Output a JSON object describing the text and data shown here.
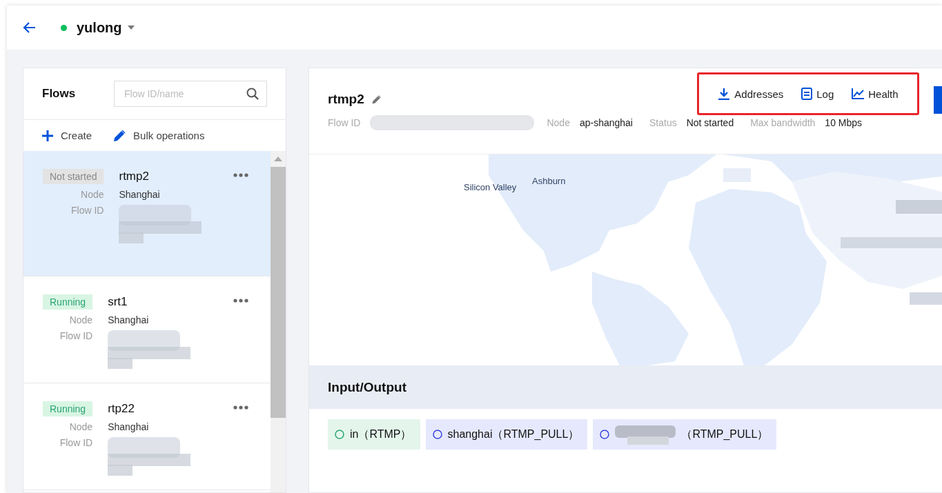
{
  "header": {
    "title": "yulong",
    "online": true
  },
  "flows": {
    "title": "Flows",
    "search": {
      "placeholder": "Flow ID/name"
    },
    "actions": [
      {
        "kind": "create",
        "label": "Create"
      },
      {
        "kind": "edit",
        "label": "Bulk operations"
      }
    ],
    "items": [
      {
        "status": "Not started",
        "kind": "idle",
        "name": "rtmp2",
        "node_label": "Node",
        "node": "Shanghai",
        "flow_id_label": "Flow ID",
        "selected": true
      },
      {
        "status": "Running",
        "kind": "running",
        "name": "srt1",
        "node_label": "Node",
        "node": "Shanghai",
        "flow_id_label": "Flow ID",
        "selected": false
      },
      {
        "status": "Running",
        "kind": "running",
        "name": "rtp22",
        "node_label": "Node",
        "node": "Shanghai",
        "flow_id_label": "Flow ID",
        "selected": false
      }
    ]
  },
  "detail": {
    "name": "rtmp2",
    "meta": [
      {
        "label": "Flow ID",
        "redacted": true
      },
      {
        "label": "Node",
        "value": "ap-shanghai"
      },
      {
        "label": "Status",
        "value": "Not started"
      },
      {
        "label": "Max bandwidth",
        "value": "10 Mbps"
      }
    ],
    "actions": [
      {
        "kind": "download",
        "label": "Addresses"
      },
      {
        "kind": "log",
        "label": "Log"
      },
      {
        "kind": "chart",
        "label": "Health"
      }
    ],
    "map_labels": [
      "Silicon Valley",
      "Ashburn"
    ],
    "io_title": "Input/Output",
    "io_items": [
      {
        "kind": "input",
        "label": "in（RTMP）"
      },
      {
        "kind": "output",
        "label": "shanghai（RTMP_PULL）"
      },
      {
        "kind": "output",
        "redacted": true,
        "label": "（RTMP_PULL）"
      }
    ]
  }
}
